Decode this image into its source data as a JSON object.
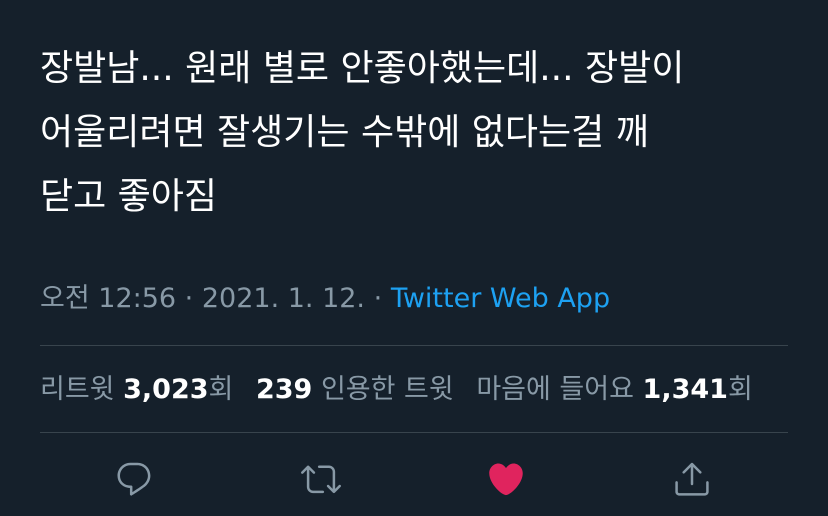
{
  "tweet": {
    "lines": [
      "장발남... 원래 별로 안좋아했는데... 장발이",
      "어울리려면 잘생기는 수밖에 없다는걸 깨",
      "닫고 좋아짐"
    ]
  },
  "meta": {
    "time": "오전 12:56",
    "separator": "·",
    "date": "2021. 1. 12.",
    "app": "Twitter Web App"
  },
  "stats": {
    "retweet_label": "리트윗",
    "retweet_count": "3,023",
    "retweet_unit": "회",
    "quote_count": "239",
    "quote_label": "인용한 트윗",
    "like_label": "마음에 들어요",
    "like_count": "1,341",
    "like_unit": "회"
  },
  "actions": [
    {
      "icon": "reply-icon"
    },
    {
      "icon": "retweet-icon"
    },
    {
      "icon": "heart-icon"
    },
    {
      "icon": "share-icon"
    }
  ],
  "colors": {
    "background": "#15202b",
    "text": "#ffffff",
    "secondary": "#8899a6",
    "link": "#1da1f2",
    "like": "#e0245e",
    "divider": "#38444d"
  }
}
